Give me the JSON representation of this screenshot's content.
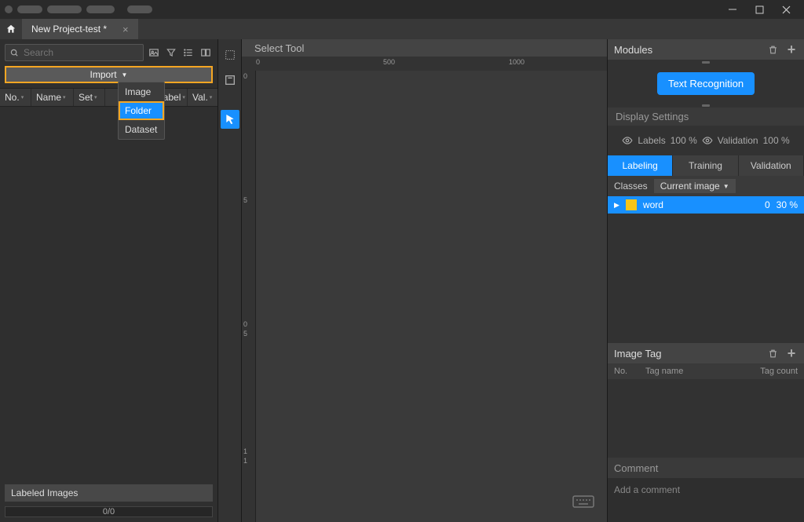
{
  "titlebar": {
    "project_tab": "New Project-test *"
  },
  "left": {
    "search_placeholder": "Search",
    "import_label": "Import",
    "import_menu": {
      "image": "Image",
      "folder": "Folder",
      "dataset": "Dataset"
    },
    "columns": {
      "no": "No.",
      "name": "Name",
      "set": "Set",
      "label": "Label",
      "val": "Val."
    },
    "labeled_images": "Labeled Images",
    "progress_text": "0/0"
  },
  "canvas": {
    "tool_title": "Select Tool",
    "ruler_h": [
      "0",
      "500",
      "1000"
    ],
    "ruler_v": [
      "0",
      "5",
      "0",
      "5",
      "1",
      "1"
    ]
  },
  "right": {
    "modules_title": "Modules",
    "text_recog_btn": "Text Recognition",
    "display_settings": "Display Settings",
    "labels_label": "Labels",
    "labels_pct": "100 %",
    "validation_label": "Validation",
    "validation_pct": "100 %",
    "tabs": {
      "labeling": "Labeling",
      "training": "Training",
      "validation": "Validation"
    },
    "classes_label": "Classes",
    "scope_dropdown": "Current image",
    "class_row": {
      "name": "word",
      "count": "0",
      "pct": "30 %"
    },
    "image_tag_title": "Image Tag",
    "tag_cols": {
      "no": "No.",
      "name": "Tag name",
      "count": "Tag count"
    },
    "comment_title": "Comment",
    "comment_placeholder": "Add a comment"
  }
}
